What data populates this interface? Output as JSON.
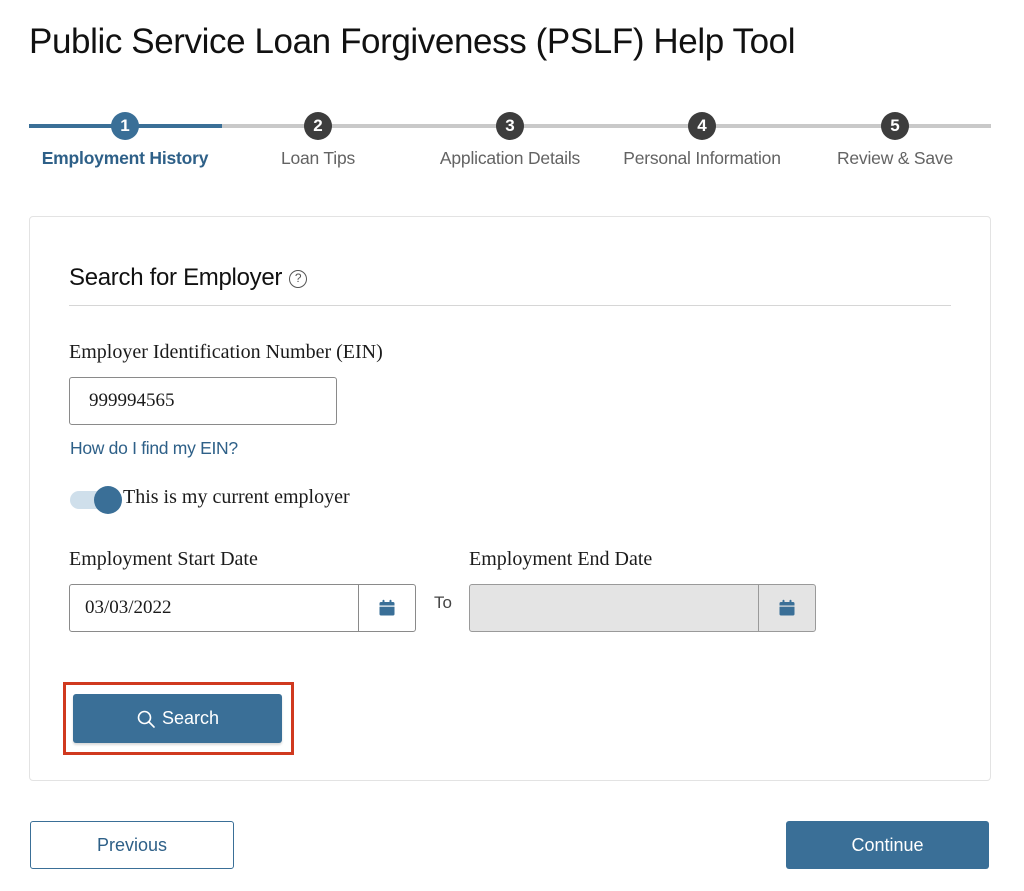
{
  "page": {
    "title": "Public Service Loan Forgiveness (PSLF) Help Tool"
  },
  "stepper": {
    "current_step": 1,
    "steps": [
      {
        "number": "1",
        "label": "Employment History",
        "active": true
      },
      {
        "number": "2",
        "label": "Loan Tips",
        "active": false
      },
      {
        "number": "3",
        "label": "Application Details",
        "active": false
      },
      {
        "number": "4",
        "label": "Personal Information",
        "active": false
      },
      {
        "number": "5",
        "label": "Review & Save",
        "active": false
      }
    ]
  },
  "search_section": {
    "heading": "Search for Employer",
    "help_icon": "question-circle-icon",
    "ein_label": "Employer Identification Number (EIN)",
    "ein_value": "999994565",
    "ein_help_link": "How do I find my EIN?",
    "current_employer_label": "This is my current employer",
    "current_employer_checked": true,
    "start_date_label": "Employment Start Date",
    "start_date_value": "03/03/2022",
    "to_label": "To",
    "end_date_label": "Employment End Date",
    "end_date_value": "",
    "end_date_disabled": true,
    "calendar_icon": "calendar-icon",
    "search_button": "Search",
    "search_icon": "search-icon"
  },
  "footer": {
    "previous_button": "Previous",
    "continue_button": "Continue"
  },
  "colors": {
    "primary": "#3a6f97",
    "link": "#2e6088",
    "inactive_step": "#3d3d3d",
    "highlight": "#d0391f"
  }
}
